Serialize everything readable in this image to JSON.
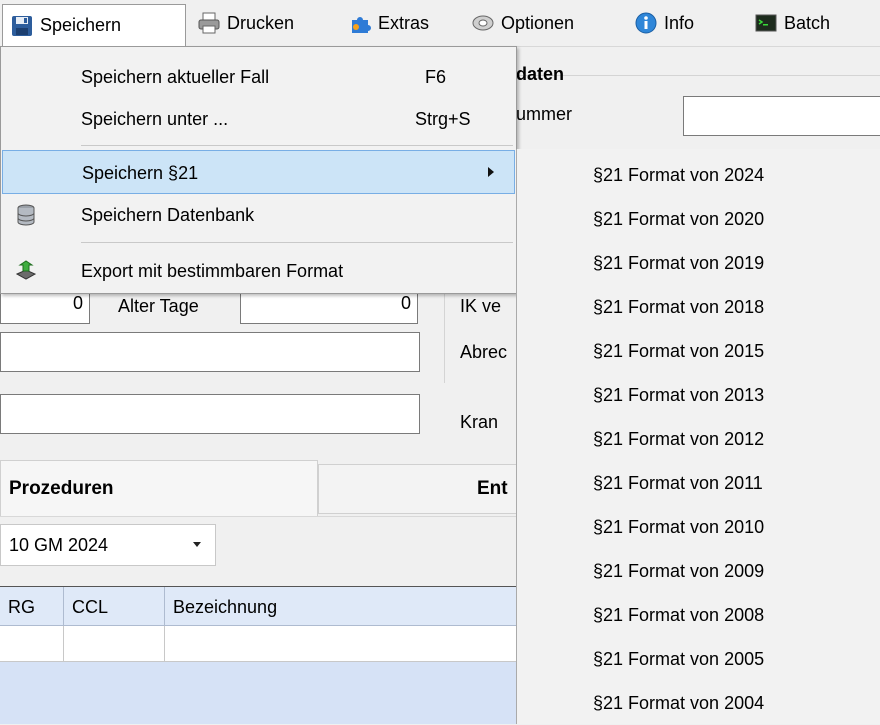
{
  "menubar": {
    "items": [
      {
        "label": "Speichern",
        "icon": "floppy-disk-icon"
      },
      {
        "label": "Drucken",
        "icon": "printer-icon"
      },
      {
        "label": "Extras",
        "icon": "puzzle-icon"
      },
      {
        "label": "Optionen",
        "icon": "tape-icon"
      },
      {
        "label": "Info",
        "icon": "info-icon"
      },
      {
        "label": "Batch",
        "icon": "terminal-icon"
      }
    ]
  },
  "dropdown": {
    "items": [
      {
        "label": "Speichern aktueller Fall",
        "shortcut": "F6"
      },
      {
        "label": "Speichern unter ...",
        "shortcut": "Strg+S"
      },
      {
        "label": "Speichern §21",
        "shortcut": ""
      },
      {
        "label": "Speichern Datenbank",
        "shortcut": "",
        "icon": "database-icon"
      },
      {
        "label": "Export mit bestimmbaren Format",
        "shortcut": "",
        "icon": "export-icon"
      }
    ]
  },
  "submenu": {
    "items": [
      "§21 Format von 2024",
      "§21 Format von 2020",
      "§21 Format von 2019",
      "§21 Format von 2018",
      "§21 Format von 2015",
      "§21 Format von 2013",
      "§21 Format von 2012",
      "§21 Format von 2011",
      "§21 Format von 2010",
      "§21 Format von 2009",
      "§21 Format von 2008",
      "§21 Format von 2005",
      "§21 Format von 2004"
    ]
  },
  "background": {
    "header_fragment": "daten",
    "label_nummer": "ummer",
    "field_left_value": "0",
    "label_alter_tage": "Alter Tage",
    "field_alter_tage_value": "0",
    "label_ik": "IK ve",
    "label_abrec": "Abrec",
    "label_kran": "Kran",
    "tab_prozeduren": "Prozeduren",
    "tab_ent": "Ent",
    "combo_value": "10 GM 2024",
    "table_headers": [
      "RG",
      "CCL",
      "Bezeichnung"
    ]
  },
  "colors": {
    "selected_bg": "#cce4f7",
    "selected_border": "#78aee5",
    "table_bg": "#d6e2f6"
  }
}
